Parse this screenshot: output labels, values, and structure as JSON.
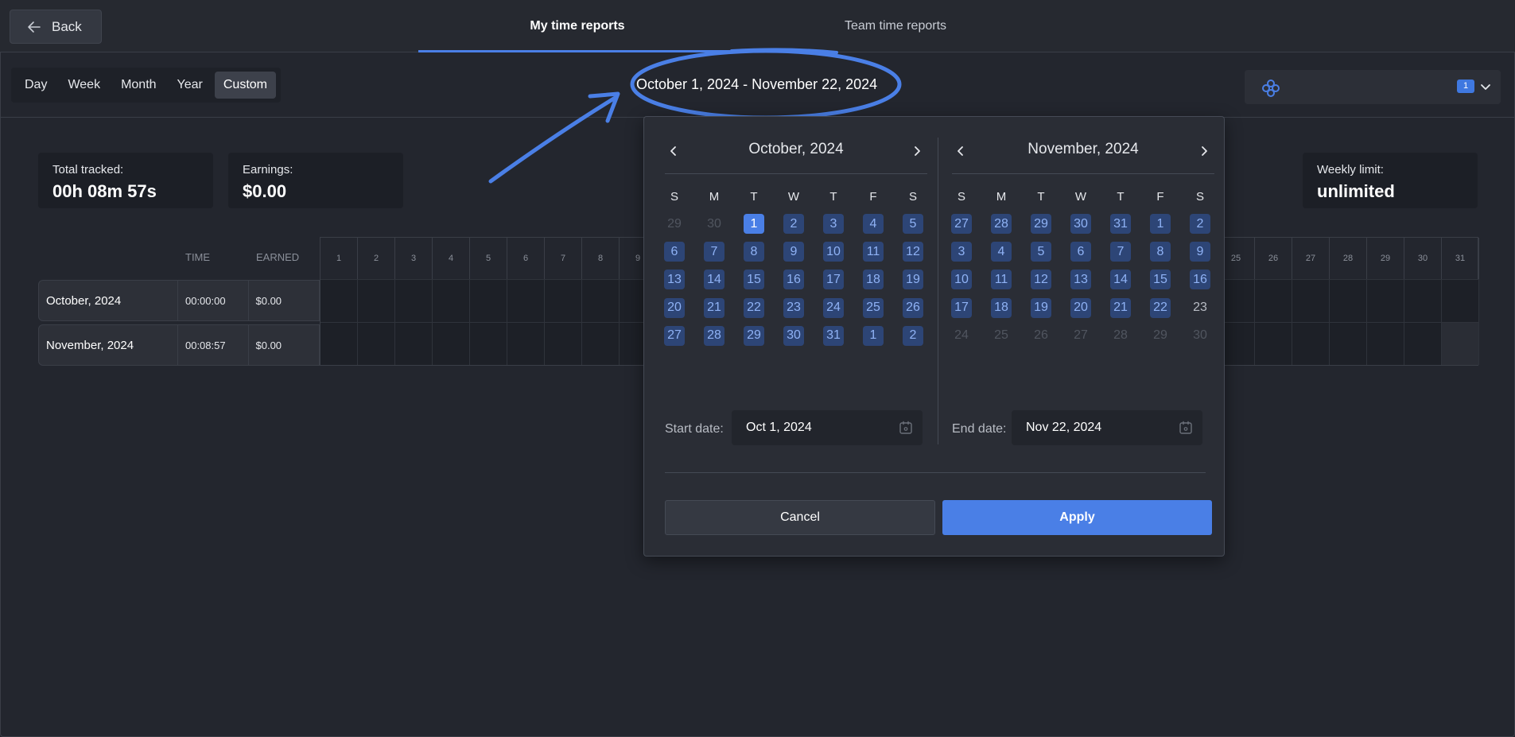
{
  "header": {
    "back_label": "Back",
    "tabs": [
      {
        "label": "My time reports",
        "active": true
      },
      {
        "label": "Team time reports",
        "active": false
      }
    ]
  },
  "range_bar": {
    "periods": [
      "Day",
      "Week",
      "Month",
      "Year",
      "Custom"
    ],
    "active_period": "Custom",
    "range_label": "October 1, 2024 - November 22, 2024",
    "project_count": "1"
  },
  "stats": [
    {
      "label": "Total tracked:",
      "value": "00h 08m 57s"
    },
    {
      "label": "Earnings:",
      "value": "$0.00"
    },
    {
      "label": "Weekly limit:",
      "value": "unlimited"
    }
  ],
  "table": {
    "col_time": "TIME",
    "col_earned": "EARNED",
    "day_headers_left": [
      "1",
      "2",
      "3",
      "4",
      "5",
      "6",
      "7",
      "8",
      "9"
    ],
    "day_headers_right": [
      "25",
      "26",
      "27",
      "28",
      "29",
      "30",
      "31"
    ],
    "rows": [
      {
        "name": "October, 2024",
        "time": "00:00:00",
        "earned": "$0.00"
      },
      {
        "name": "November, 2024",
        "time": "00:08:57",
        "earned": "$0.00"
      }
    ]
  },
  "picker": {
    "weekdays": [
      "S",
      "M",
      "T",
      "W",
      "T",
      "F",
      "S"
    ],
    "left_title": "October, 2024",
    "right_title": "November, 2024",
    "left_days": [
      [
        "29",
        "m"
      ],
      [
        "30",
        "m"
      ],
      [
        "1",
        "s"
      ],
      [
        "2",
        "r"
      ],
      [
        "3",
        "r"
      ],
      [
        "4",
        "r"
      ],
      [
        "5",
        "r"
      ],
      [
        "6",
        "r"
      ],
      [
        "7",
        "r"
      ],
      [
        "8",
        "r"
      ],
      [
        "9",
        "r"
      ],
      [
        "10",
        "r"
      ],
      [
        "11",
        "r"
      ],
      [
        "12",
        "r"
      ],
      [
        "13",
        "r"
      ],
      [
        "14",
        "r"
      ],
      [
        "15",
        "r"
      ],
      [
        "16",
        "r"
      ],
      [
        "17",
        "r"
      ],
      [
        "18",
        "r"
      ],
      [
        "19",
        "r"
      ],
      [
        "20",
        "r"
      ],
      [
        "21",
        "r"
      ],
      [
        "22",
        "r"
      ],
      [
        "23",
        "r"
      ],
      [
        "24",
        "r"
      ],
      [
        "25",
        "r"
      ],
      [
        "26",
        "r"
      ],
      [
        "27",
        "r"
      ],
      [
        "28",
        "r"
      ],
      [
        "29",
        "r"
      ],
      [
        "30",
        "r"
      ],
      [
        "31",
        "r"
      ],
      [
        "1",
        "r"
      ],
      [
        "2",
        "r"
      ]
    ],
    "right_days": [
      [
        "27",
        "r"
      ],
      [
        "28",
        "r"
      ],
      [
        "29",
        "r"
      ],
      [
        "30",
        "r"
      ],
      [
        "31",
        "r"
      ],
      [
        "1",
        "r"
      ],
      [
        "2",
        "r"
      ],
      [
        "3",
        "r"
      ],
      [
        "4",
        "r"
      ],
      [
        "5",
        "r"
      ],
      [
        "6",
        "r"
      ],
      [
        "7",
        "r"
      ],
      [
        "8",
        "r"
      ],
      [
        "9",
        "r"
      ],
      [
        "10",
        "r"
      ],
      [
        "11",
        "r"
      ],
      [
        "12",
        "r"
      ],
      [
        "13",
        "r"
      ],
      [
        "14",
        "r"
      ],
      [
        "15",
        "r"
      ],
      [
        "16",
        "r"
      ],
      [
        "17",
        "r"
      ],
      [
        "18",
        "r"
      ],
      [
        "19",
        "r"
      ],
      [
        "20",
        "r"
      ],
      [
        "21",
        "r"
      ],
      [
        "22",
        "r"
      ],
      [
        "23",
        "p"
      ],
      [
        "24",
        "m"
      ],
      [
        "25",
        "m"
      ],
      [
        "26",
        "m"
      ],
      [
        "27",
        "m"
      ],
      [
        "28",
        "m"
      ],
      [
        "29",
        "m"
      ],
      [
        "30",
        "m"
      ]
    ],
    "start_label": "Start date:",
    "start_value": "Oct 1, 2024",
    "end_label": "End date:",
    "end_value": "Nov 22, 2024",
    "cancel_label": "Cancel",
    "apply_label": "Apply"
  },
  "colors": {
    "accent": "#4a7fe6",
    "range_fill": "#2d4576",
    "annotation": "#4a7fe6",
    "background": "#23262e"
  }
}
